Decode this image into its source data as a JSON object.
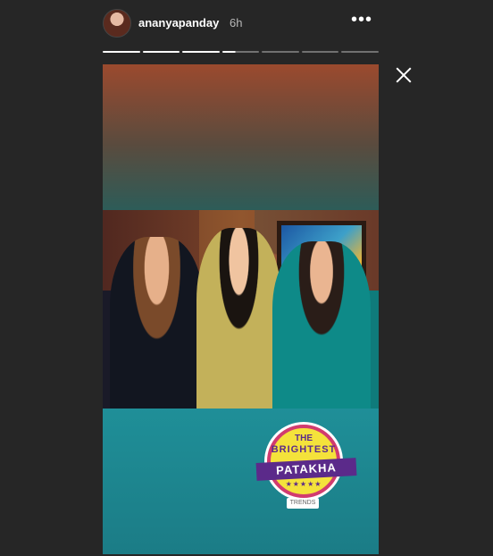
{
  "header": {
    "username": "ananyapanday",
    "timestamp": "6h",
    "more_icon": "more-horizontal-icon",
    "more_glyph": "•••"
  },
  "story": {
    "progress_segments": 7,
    "completed_segments": 3,
    "current_segment_progress": 0.35
  },
  "sticker": {
    "line1": "THE",
    "line2": "BRIGHTEST",
    "banner": "PATAKHA",
    "stars": "★★★★★",
    "brand": "TRENDS"
  },
  "colors": {
    "background": "#262626",
    "top_gradient_start": "#9b4a2e",
    "bottom_panel": "#1f8f98",
    "sticker_yellow": "#f4e23b",
    "sticker_purple": "#5b2a8a"
  },
  "close_icon": "close-icon"
}
